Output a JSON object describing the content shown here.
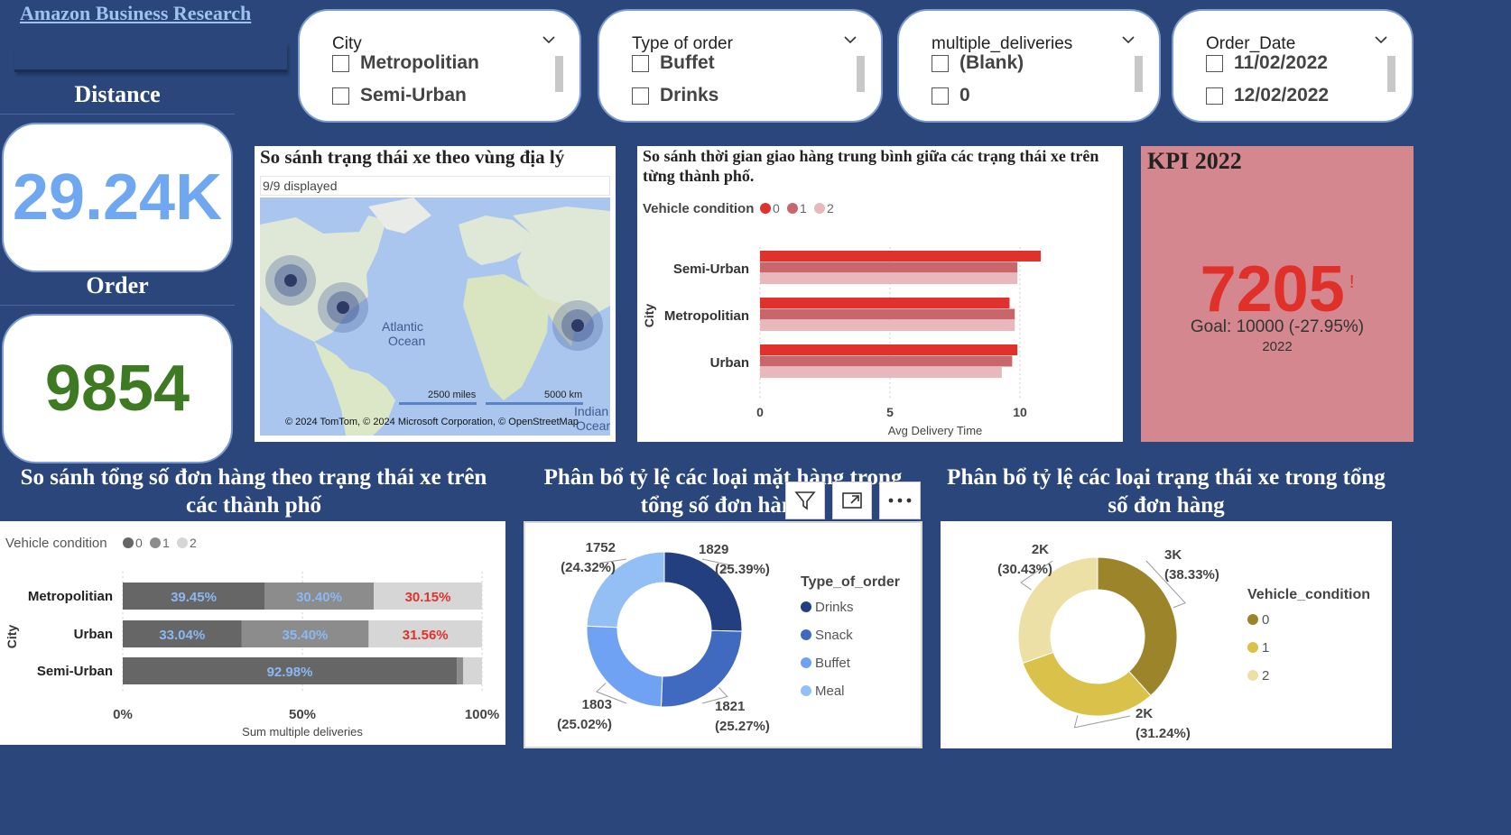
{
  "header": {
    "title": "Amazon Business Research"
  },
  "kpis": {
    "distance": {
      "label": "Distance",
      "value": "29.24K",
      "color": "#6fa8f0"
    },
    "order": {
      "label": "Order",
      "value": "9854",
      "color": "#3d7a22"
    }
  },
  "slicers": [
    {
      "title": "City",
      "options": [
        "Metropolitian",
        "Semi-Urban"
      ]
    },
    {
      "title": "Type of order",
      "options": [
        "Buffet",
        "Drinks"
      ]
    },
    {
      "title": "multiple_deliveries",
      "options": [
        "(Blank)",
        "0"
      ]
    },
    {
      "title": "Order_Date",
      "options": [
        "11/02/2022",
        "12/02/2022"
      ]
    }
  ],
  "map": {
    "title": "So sánh trạng thái xe theo vùng địa lý",
    "displayed": "9/9 displayed",
    "labels": {
      "atlantic": "Atlantic",
      "ocean": "Ocean",
      "indian": "Indian",
      "ocean2": "Ocean"
    },
    "scale_miles": "2500 miles",
    "scale_km": "5000 km",
    "attribution": "© 2024 TomTom, © 2024 Microsoft Corporation, © OpenStreetMap"
  },
  "kpi_goal": {
    "title": "KPI 2022",
    "value": "7205",
    "alert": "!",
    "goal_text": "Goal: 10000 (-27.95%)",
    "year": "2022",
    "bg": "#d4878f",
    "value_color": "#e0302a"
  },
  "chart_delivery": {
    "title": "So sánh thời gian giao hàng trung bình giữa các trạng thái xe trên từng thành phố.",
    "legend_title": "Vehicle condition",
    "colors": [
      "#e0322c",
      "#c9666c",
      "#e8b8bc"
    ],
    "chart_data": {
      "type": "bar",
      "orientation": "horizontal",
      "categories": [
        "Semi-Urban",
        "Metropolitian",
        "Urban"
      ],
      "series": [
        {
          "name": "0",
          "values": [
            10.8,
            9.6,
            9.9
          ]
        },
        {
          "name": "1",
          "values": [
            9.9,
            9.8,
            9.7
          ]
        },
        {
          "name": "2",
          "values": [
            9.9,
            9.8,
            9.3
          ]
        }
      ],
      "xlabel": "Avg Delivery Time",
      "ylabel": "City",
      "xticks": [
        "0",
        "5",
        "10"
      ],
      "xlim": [
        0,
        12.5
      ],
      "grid": true,
      "legend": "top-left"
    }
  },
  "section_titles": {
    "orders_by_city": "So sánh tổng số đơn hàng theo trạng thái xe trên các thành phố",
    "order_types": "Phân bổ tỷ lệ các loại mặt hàng trong tổng số đơn hàng",
    "vehicle_share": "Phân bổ tỷ lệ các loại trạng thái xe trong tổng số đơn hàng"
  },
  "chart_stacked": {
    "legend_title": "Vehicle condition",
    "colors": [
      "#666666",
      "#8c8c8c",
      "#d6d6d6"
    ],
    "label_colors": [
      "#8bb8f2",
      "#8bb8f2",
      "#e0322c"
    ],
    "chart_data": {
      "type": "bar",
      "orientation": "horizontal-stacked-100",
      "categories": [
        "Metropolitian",
        "Urban",
        "Semi-Urban"
      ],
      "series": [
        {
          "name": "0",
          "values": [
            39.45,
            33.04,
            92.98
          ],
          "labels": [
            "39.45%",
            "33.04%",
            "92.98%"
          ]
        },
        {
          "name": "1",
          "values": [
            30.4,
            35.4,
            1.8
          ],
          "labels": [
            "30.40%",
            "35.40%",
            ""
          ]
        },
        {
          "name": "2",
          "values": [
            30.15,
            31.56,
            5.22
          ],
          "labels": [
            "30.15%",
            "31.56%",
            ""
          ]
        }
      ],
      "xlabel": "Sum multiple deliveries",
      "ylabel": "City",
      "xticks": [
        "0%",
        "50%",
        "100%"
      ],
      "xlim": [
        0,
        100
      ],
      "legend": "top-left"
    }
  },
  "chart_order_types": {
    "legend_title": "Type_of_order",
    "colors": [
      "#233f80",
      "#3f6ac0",
      "#6fa2f2",
      "#93bff5"
    ],
    "toolbar": {
      "filter": "filter-icon",
      "focus": "focus-mode-icon",
      "more": "more-options-icon"
    },
    "chart_data": {
      "type": "pie",
      "variant": "donut",
      "categories": [
        "Drinks",
        "Snack",
        "Buffet",
        "Meal"
      ],
      "values": [
        1829,
        1821,
        1803,
        1752
      ],
      "labels": [
        [
          "1829",
          "(25.39%)"
        ],
        [
          "1821",
          "(25.27%)"
        ],
        [
          "1803",
          "(25.02%)"
        ],
        [
          "1752",
          "(24.32%)"
        ]
      ],
      "legend": "right"
    }
  },
  "chart_vehicle": {
    "legend_title": "Vehicle_condition",
    "colors": [
      "#9b8429",
      "#d9c14a",
      "#ede0a6"
    ],
    "chart_data": {
      "type": "pie",
      "variant": "donut",
      "categories": [
        "0",
        "1",
        "2"
      ],
      "values": [
        38.33,
        31.24,
        30.43
      ],
      "labels": [
        [
          "3K",
          "(38.33%)"
        ],
        [
          "2K",
          "(31.24%)"
        ],
        [
          "2K",
          "(30.43%)"
        ]
      ],
      "legend": "right"
    }
  }
}
